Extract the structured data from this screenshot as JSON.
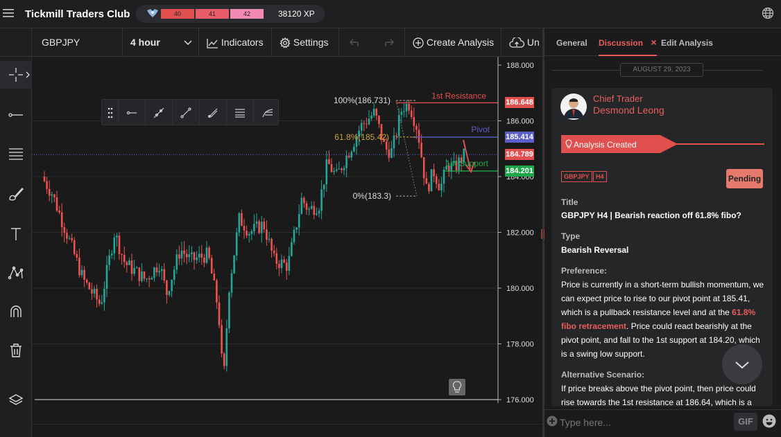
{
  "header": {
    "title": "Tickmill Traders Club",
    "levels": [
      "40",
      "41",
      "42"
    ],
    "xp": "38120 XP"
  },
  "toolbar": {
    "symbol": "GBPJPY",
    "timeframe": "4 hour",
    "indicators": "Indicators",
    "settings": "Settings",
    "create_analysis": "Create Analysis",
    "unpublish_partial": "Un"
  },
  "chart": {
    "y_ticks": [
      "188.000",
      "186.000",
      "184.000",
      "182.000",
      "180.000",
      "178.000",
      "176.000"
    ],
    "price_badges": [
      {
        "text": "186.648",
        "color": "#e0504f"
      },
      {
        "text": "185.414",
        "color": "#5b5fc7"
      },
      {
        "text": "184.789",
        "color": "#e0504f"
      },
      {
        "text": "184.201",
        "color": "#1fa64a"
      }
    ],
    "annotations": {
      "first_resistance": "1st Resistance",
      "pivot": "Pivot",
      "first_support": "1st Support",
      "fib_100": "100%(186.731)",
      "fib_618": "61.8%(185.42)",
      "fib_0": "0%(183.3)"
    },
    "colors": {
      "up": "#26a69a",
      "down": "#ef5350",
      "resistance": "#e0504f",
      "pivot": "#5b5fc7",
      "support": "#1fa64a",
      "fib": "#c8a23a"
    }
  },
  "panel": {
    "tabs": [
      {
        "label": "General"
      },
      {
        "label": "Discussion"
      },
      {
        "label": "Edit Analysis"
      }
    ],
    "tab_close": "×",
    "date": "AUGUST 29, 2023",
    "author_role": "Chief Trader",
    "author_name": "Desmond Leong",
    "analysis_banner": "Analysis Created",
    "tags": [
      "GBPJPY",
      "H4"
    ],
    "status": "Pending",
    "title_label": "Title",
    "title_value": "GBPJPY H4 | Bearish reaction off 61.8% fibo?",
    "type_label": "Type",
    "type_value": "Bearish Reversal",
    "pref_label": "Preference:",
    "pref_text_1": "Price is currently in a short-term bullish momentum, we can expect price to rise to our pivot point at 185.41, which is a pullback resistance level and at the ",
    "pref_highlight": "61.8% fibo retracement",
    "pref_text_2": ". Price could react bearishly at the pivot point, and fall to the 1st support at 184.20, which is a swing low support.",
    "alt_label": "Alternative Scenario:",
    "alt_text": "If price breaks above the pivot point, then price could rise towards the 1st resistance at 186.64, which is a",
    "composer_placeholder": "Type here...",
    "gif_label": "GIF"
  }
}
